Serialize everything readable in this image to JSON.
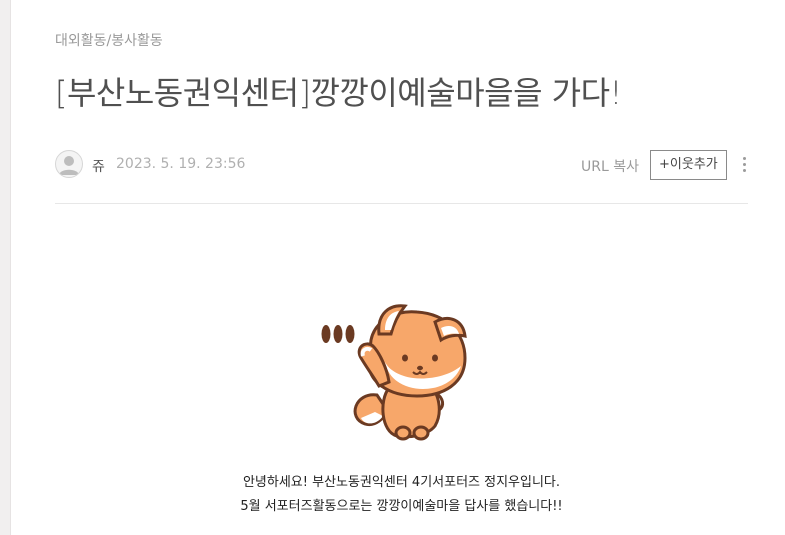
{
  "post": {
    "category": "대외활동/봉사활동",
    "title": "[부산노동권익센터]깡깡이예술마을을 가다!",
    "author": "쥬",
    "date": "2023. 5. 19. 23:56",
    "url_copy_label": "URL 복사",
    "follow_label": "+이웃추가",
    "more_icon": "more-vertical-icon",
    "avatar_icon": "default-user-icon",
    "sticker_icon": "fox-waving-sticker",
    "body_lines": [
      "안녕하세요! 부산노동권익센터 4기서포터즈 정지우입니다.",
      "5월 서포터즈활동으로는 깡깡이예술마을 답사를 했습니다!!"
    ]
  },
  "colors": {
    "fox_orange": "#f7a76a",
    "fox_outline": "#6b3a22",
    "fox_cream": "#ffffff",
    "rail": "#f1efef"
  }
}
